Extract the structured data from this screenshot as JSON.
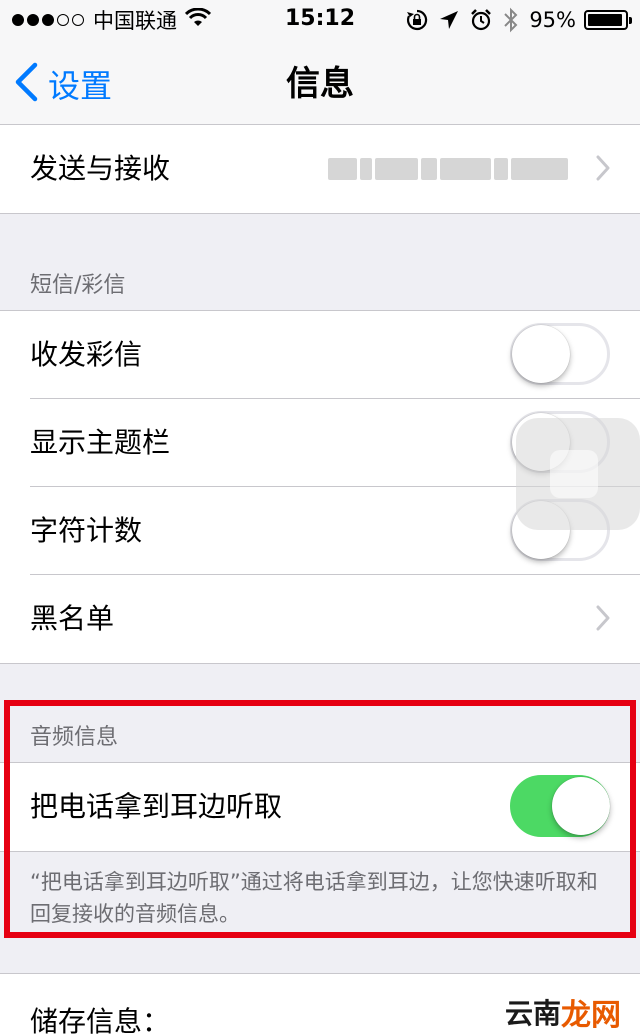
{
  "status_bar": {
    "signal_dots": [
      true,
      true,
      true,
      false,
      false
    ],
    "carrier": "中国联通",
    "time": "15:12",
    "battery_percent": "95%",
    "battery_level": 0.95,
    "icons": [
      "wifi-icon",
      "rotation-lock-icon",
      "location-icon",
      "alarm-icon",
      "bluetooth-icon",
      "battery-icon"
    ]
  },
  "navbar": {
    "back_label": "设置",
    "title": "信息"
  },
  "group_send": {
    "items": [
      {
        "label": "发送与接收",
        "value_blurred": true
      }
    ]
  },
  "section_sms": {
    "header": "短信/彩信",
    "items": [
      {
        "label": "收发彩信",
        "toggle": false
      },
      {
        "label": "显示主题栏",
        "toggle": false
      },
      {
        "label": "字符计数",
        "toggle": false
      },
      {
        "label": "黑名单",
        "chevron": true
      }
    ]
  },
  "section_audio": {
    "header": "音频信息",
    "items": [
      {
        "label": "把电话拿到耳边听取",
        "toggle": true
      }
    ],
    "footer": "“把电话拿到耳边听取”通过将电话拿到耳边，让您快速听取和回复接收的音频信息。"
  },
  "section_storage": {
    "items": [
      {
        "label": "储存信息："
      }
    ]
  },
  "watermark": {
    "part1": "云南",
    "part2": "龙网"
  },
  "colors": {
    "accent": "#007aff",
    "toggle_on": "#4cd964",
    "highlight_border": "#e60012",
    "background": "#efeff4"
  }
}
